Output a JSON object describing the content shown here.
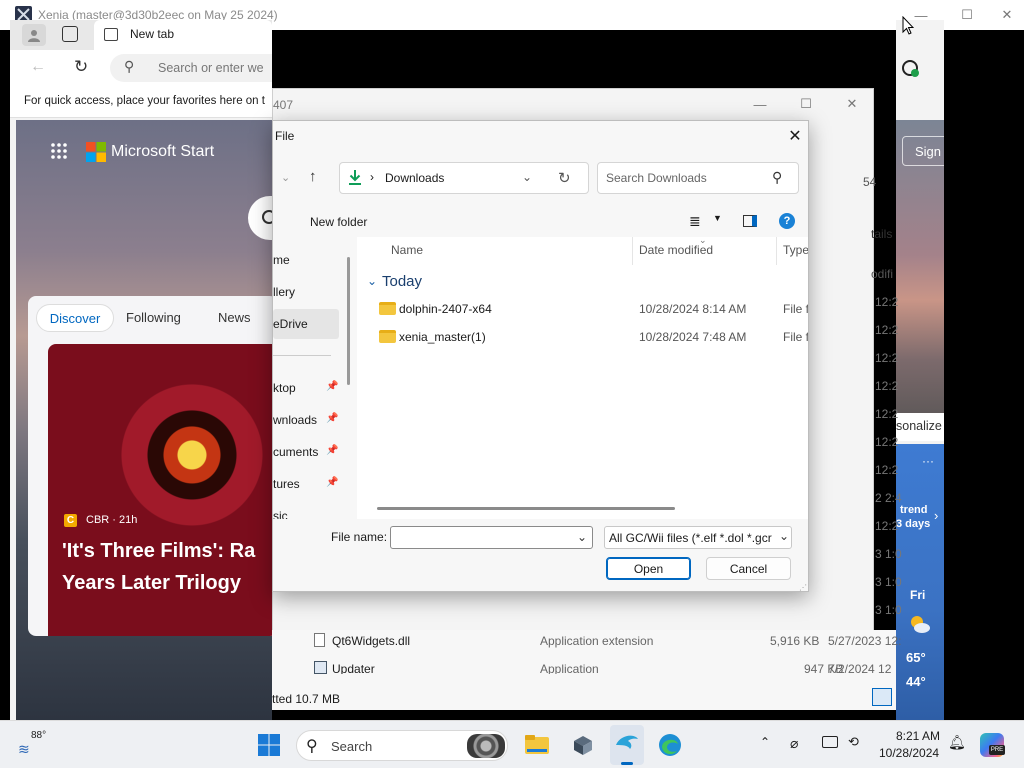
{
  "xenia": {
    "title": "Xenia (master@3d30b2eec on May 25 2024)"
  },
  "edge": {
    "tab_title": "New tab",
    "address_placeholder": "Search or enter we",
    "favorites_hint": "For quick access, place your favorites here on t",
    "msn": {
      "brand": "Microsoft Start",
      "tabs": [
        "Discover",
        "Following",
        "News"
      ],
      "story_source": "CBR · 21h",
      "headline_1": "'It's Three Films': Ra",
      "headline_2": "Years Later Trilogy"
    },
    "sign_in_label": "Sign",
    "personalize_label": "sonalize",
    "weather": {
      "trend_1": "trend",
      "trend_2": "3 days",
      "day": "Fri",
      "high": "65°",
      "low": "44°"
    }
  },
  "background_window": {
    "title_fragment": "407",
    "col_fragments": [
      "54",
      "tails",
      "odifi"
    ],
    "time_fragments": [
      "12:2",
      "12:2",
      "12:2",
      "12:2",
      "12:2",
      "12:2",
      "12:2",
      "2 2:4",
      "12:2",
      "3 1:0",
      "3 1:0",
      "3 1:0"
    ],
    "rows": [
      {
        "name": "Qt6Widgets.dll",
        "type": "Application extension",
        "size": "5,916 KB",
        "date": "5/27/2023 12:"
      },
      {
        "name": "Updater",
        "type": "Application",
        "size": "947 KB",
        "date": "7/2/2024 12:2"
      }
    ],
    "status": "tted 10.7 MB"
  },
  "dialog": {
    "title": "File",
    "address": "Downloads",
    "search_placeholder": "Search Downloads",
    "new_folder": "New folder",
    "nav_items": [
      "me",
      "llery",
      "eDrive",
      "ktop",
      "wnloads",
      "cuments",
      "tures",
      "sic"
    ],
    "columns": {
      "name": "Name",
      "date": "Date modified",
      "type": "Type"
    },
    "group": "Today",
    "files": [
      {
        "name": "dolphin-2407-x64",
        "date": "10/28/2024 8:14 AM",
        "type": "File fo"
      },
      {
        "name": "xenia_master(1)",
        "date": "10/28/2024 7:48 AM",
        "type": "File fo"
      }
    ],
    "file_name_label": "File name:",
    "file_name_value": "",
    "filter": "All GC/Wii files (*.elf *.dol *.gcr",
    "open_label": "Open",
    "cancel_label": "Cancel"
  },
  "taskbar": {
    "temp": "88°",
    "search_label": "Search",
    "time": "8:21 AM",
    "date": "10/28/2024"
  },
  "colors": {
    "accent": "#0067c0",
    "folder": "#f3c63e",
    "download_green": "#0f9d58"
  }
}
